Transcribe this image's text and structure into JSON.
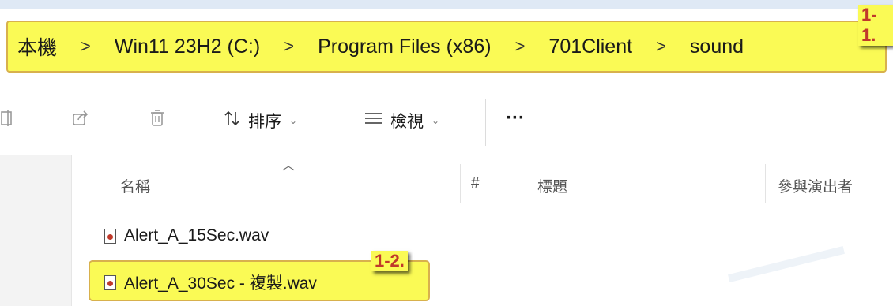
{
  "breadcrumb": {
    "items": [
      "本機",
      "Win11 23H2 (C:)",
      "Program Files (x86)",
      "701Client",
      "sound"
    ],
    "separator": ">"
  },
  "annotations": {
    "tag_1": "1-1.",
    "tag_2": "1-2."
  },
  "toolbar": {
    "sort_label": "排序",
    "view_label": "檢視",
    "more_label": "···",
    "sort_icon": "sort-icon",
    "view_icon": "view-icon"
  },
  "columns": {
    "name": "名稱",
    "number": "#",
    "title": "標題",
    "contributing_artists": "參與演出者"
  },
  "files": [
    {
      "name": "Alert_A_15Sec.wav",
      "icon": "audio-file-icon"
    },
    {
      "name": "Alert_A_30Sec - 複製.wav",
      "icon": "audio-file-icon"
    }
  ],
  "colors": {
    "highlight": "#fafa55",
    "highlight_border": "#d8b14d",
    "tag_text": "#c0392b"
  }
}
